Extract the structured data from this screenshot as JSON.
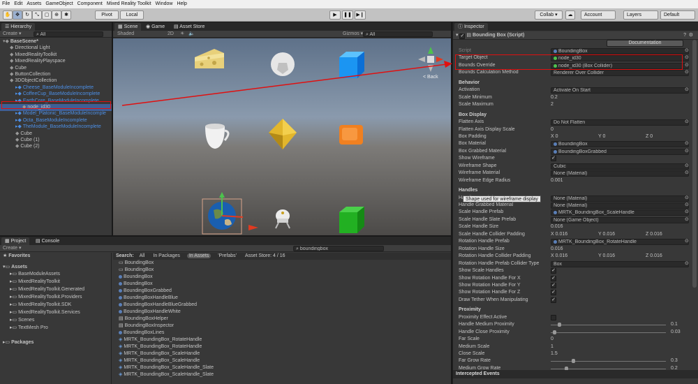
{
  "menu": [
    "File",
    "Edit",
    "Assets",
    "GameObject",
    "Component",
    "Mixed Reality Toolkit",
    "Window",
    "Help"
  ],
  "toolbar": {
    "pivot": "Pivot",
    "local": "Local",
    "collab": "Collab ▾",
    "account": "Account",
    "layers": "Layers",
    "layout": "Default"
  },
  "hierarchy": {
    "tab": "Hierarchy",
    "create": "Create ▾",
    "search_placeholder": "All",
    "items": [
      {
        "label": "BaseScene*"
      },
      {
        "label": "Directional Light"
      },
      {
        "label": "MixedRealityToolkit"
      },
      {
        "label": "MixedRealityPlayspace"
      },
      {
        "label": "Cube"
      },
      {
        "label": "ButtonCollection"
      },
      {
        "label": "3DObjectCollection"
      },
      {
        "label": "Cheese_BaseModuleIncomplete"
      },
      {
        "label": "CoffeeCup_BaseModuleIncomplete"
      },
      {
        "label": "EarthCore_BaseModuleIncomplete"
      },
      {
        "label": "node_id30"
      },
      {
        "label": "Model_Platonic_BaseModuleIncomple"
      },
      {
        "label": "Octa_BaseModuleIncomplete"
      },
      {
        "label": "TheModule_BaseModuleIncomplete"
      },
      {
        "label": "Cube"
      },
      {
        "label": "Cube (1)"
      },
      {
        "label": "Cube (2)"
      }
    ]
  },
  "scene": {
    "tab_scene": "Scene",
    "tab_game": "Game",
    "tab_store": "Asset Store",
    "shaded": "Shaded",
    "mode2d": "2D",
    "gizmos": "Gizmos ▾",
    "search": "All",
    "back_label": "< Back"
  },
  "project": {
    "tab_project": "Project",
    "tab_console": "Console",
    "create": "Create ▾",
    "favorites": "Favorites",
    "assets": "Assets",
    "packages": "Packages",
    "folders": [
      "BaseModuleAssets",
      "MixedRealityToolkit",
      "MixedRealityToolkit.Generated",
      "MixedRealityToolkit.Providers",
      "MixedRealityToolkit.SDK",
      "MixedRealityToolkit.Services",
      "Scenes",
      "TextMesh Pro"
    ],
    "search_value": "boundingbox",
    "search_label": "Search:",
    "filter_all": "All",
    "filter_packages": "In Packages",
    "filter_assets": "In Assets",
    "filter_prefabs": "'Prefabs'",
    "store_count": "Asset Store: 4 / 16",
    "results": [
      "BoundingBox",
      "BoundingBox",
      "BoundingBox",
      "BoundingBox",
      "BoundingBoxGrabbed",
      "BoundingBoxHandleBlue",
      "BoundingBoxHandleBlueGrabbed",
      "BoundingBoxHandleWhite",
      "BoundingBoxHelper",
      "BoundingBoxInspector",
      "BoundingBoxLines",
      "MRTK_BoundingBox_RotateHandle",
      "MRTK_BoundingBox_RotateHandle",
      "MRTK_BoundingBox_ScaleHandle",
      "MRTK_BoundingBox_ScaleHandle",
      "MRTK_BoundingBox_ScaleHandle_Slate",
      "MRTK_BoundingBox_ScaleHandle_Slate"
    ]
  },
  "inspector": {
    "tab": "Inspector",
    "component": "Bounding Box (Script)",
    "documentation": "Documentation",
    "tooltip": "Shape used for wireframe display",
    "footer": "Intercepted Events",
    "rows": [
      {
        "label": "Script",
        "value": "BoundingBox",
        "kind": "field"
      },
      {
        "label": "Target Object",
        "value": "node_id30",
        "kind": "field"
      },
      {
        "label": "Bounds Override",
        "value": "node_id30 (Box Collider)",
        "kind": "field"
      },
      {
        "label": "Bounds Calculation Method",
        "value": "Renderer Over Collider",
        "kind": "field"
      },
      {
        "label": "Behavior",
        "kind": "section"
      },
      {
        "label": "Activation",
        "value": "Activate On Start",
        "kind": "field"
      },
      {
        "label": "Scale Minimum",
        "value": "0.2",
        "kind": "text"
      },
      {
        "label": "Scale Maximum",
        "value": "2",
        "kind": "text"
      },
      {
        "label": "Box Display",
        "kind": "section"
      },
      {
        "label": "Flatten Axis",
        "value": "Do Not Flatten",
        "kind": "field"
      },
      {
        "label": "Flatten Axis Display Scale",
        "value": "0",
        "kind": "text"
      },
      {
        "label": "Box Padding",
        "x": "0",
        "y": "0",
        "z": "0",
        "kind": "xyz"
      },
      {
        "label": "Box Material",
        "value": "BoundingBox",
        "kind": "field"
      },
      {
        "label": "Box Grabbed Material",
        "value": "BoundingBoxGrabbed",
        "kind": "field"
      },
      {
        "label": "Show Wireframe",
        "value": "✓",
        "kind": "check"
      },
      {
        "label": "Wireframe Shape",
        "value": "Cubic",
        "kind": "field"
      },
      {
        "label": "Wireframe Material",
        "value": "None (Material)",
        "kind": "field"
      },
      {
        "label": "Wireframe Edge Radius",
        "value": "0.001",
        "kind": "text"
      },
      {
        "label": "Handles",
        "kind": "section"
      },
      {
        "label": "Handle Material",
        "value": "None (Material)",
        "kind": "field"
      },
      {
        "label": "Handle Grabbed Material",
        "value": "None (Material)",
        "kind": "field"
      },
      {
        "label": "Scale Handle Prefab",
        "value": "MRTK_BoundingBox_ScaleHandle",
        "kind": "field"
      },
      {
        "label": "Scale Handle Slate Prefab",
        "value": "None (Game Object)",
        "kind": "field"
      },
      {
        "label": "Scale Handle Size",
        "value": "0.016",
        "kind": "text"
      },
      {
        "label": "Scale Handle Collider Padding",
        "x": "0.016",
        "y": "0.016",
        "z": "0.016",
        "kind": "xyz"
      },
      {
        "label": "Rotation Handle Prefab",
        "value": "MRTK_BoundingBox_RotateHandle",
        "kind": "field"
      },
      {
        "label": "Rotation Handle Size",
        "value": "0.016",
        "kind": "text"
      },
      {
        "label": "Rotation Handle Collider Padding",
        "x": "0.016",
        "y": "0.016",
        "z": "0.016",
        "kind": "xyz"
      },
      {
        "label": "Rotation Handle Prefab Collider Type",
        "value": "Box",
        "kind": "field"
      },
      {
        "label": "Show Scale Handles",
        "value": "✓",
        "kind": "check"
      },
      {
        "label": "Show Rotation Handle For X",
        "value": "✓",
        "kind": "check"
      },
      {
        "label": "Show Rotation Handle For Y",
        "value": "✓",
        "kind": "check"
      },
      {
        "label": "Show Rotation Handle For Z",
        "value": "✓",
        "kind": "check"
      },
      {
        "label": "Draw Tether When Manipulating",
        "value": "✓",
        "kind": "check"
      },
      {
        "label": "Proximity",
        "kind": "section"
      },
      {
        "label": "Proximity Effect Active",
        "value": "",
        "kind": "check"
      },
      {
        "label": "Handle Medium Proximity",
        "value": "0.1",
        "kind": "slider"
      },
      {
        "label": "Handle Close Proximity",
        "value": "0.03",
        "kind": "slider"
      },
      {
        "label": "Far Scale",
        "value": "0",
        "kind": "text"
      },
      {
        "label": "Medium Scale",
        "value": "1",
        "kind": "text"
      },
      {
        "label": "Close Scale",
        "value": "1.5",
        "kind": "text"
      },
      {
        "label": "Far Grow Rate",
        "value": "0.3",
        "kind": "slider"
      },
      {
        "label": "Medium Grow Rate",
        "value": "0.2",
        "kind": "slider"
      }
    ]
  },
  "colors": {
    "accent_blue": "#4c8fe6",
    "highlight_red": "#e01010",
    "panel": "#383838"
  }
}
